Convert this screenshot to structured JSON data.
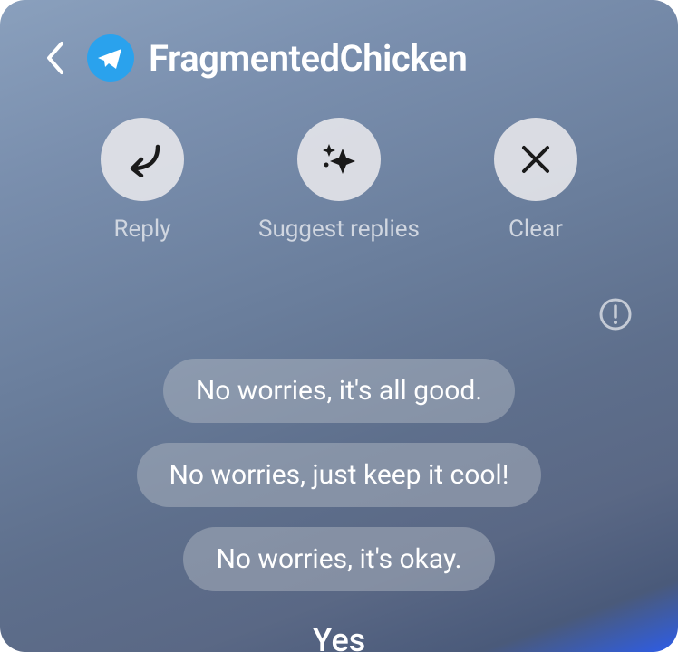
{
  "header": {
    "title": "FragmentedChicken"
  },
  "actions": {
    "reply": "Reply",
    "suggest": "Suggest replies",
    "clear": "Clear"
  },
  "suggestions": [
    "No worries, it's all good.",
    "No worries, just keep it cool!",
    "No worries, it's okay."
  ],
  "footer": {
    "label": "Yes"
  }
}
